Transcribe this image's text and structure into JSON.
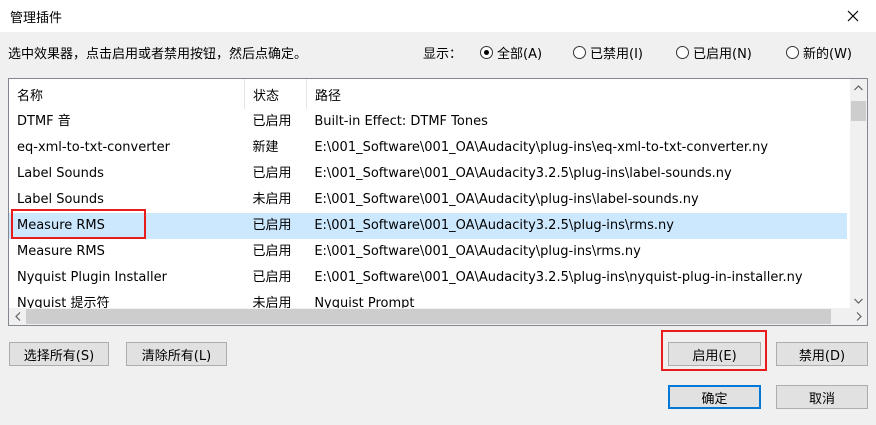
{
  "window": {
    "title": "管理插件"
  },
  "instruction": "选中效果器，点击启用或者禁用按钮，然后点确定。",
  "filter": {
    "label": "显示：",
    "options": [
      {
        "label": "全部(A)",
        "selected": true
      },
      {
        "label": "已禁用(I)",
        "selected": false
      },
      {
        "label": "已启用(N)",
        "selected": false
      },
      {
        "label": "新的(W)",
        "selected": false
      }
    ]
  },
  "list": {
    "headers": [
      "名称",
      "状态",
      "路径"
    ],
    "rows": [
      {
        "name": "DTMF 音",
        "status": "已启用",
        "path": "Built-in Effect: DTMF Tones"
      },
      {
        "name": "eq-xml-to-txt-converter",
        "status": "新建",
        "path": "E:\\001_Software\\001_OA\\Audacity\\plug-ins\\eq-xml-to-txt-converter.ny"
      },
      {
        "name": "Label Sounds",
        "status": "已启用",
        "path": "E:\\001_Software\\001_OA\\Audacity3.2.5\\plug-ins\\label-sounds.ny"
      },
      {
        "name": "Label Sounds",
        "status": "未启用",
        "path": "E:\\001_Software\\001_OA\\Audacity\\plug-ins\\label-sounds.ny"
      },
      {
        "name": "Measure RMS",
        "status": "已启用",
        "path": "E:\\001_Software\\001_OA\\Audacity3.2.5\\plug-ins\\rms.ny",
        "selected": true
      },
      {
        "name": "Measure RMS",
        "status": "已启用",
        "path": "E:\\001_Software\\001_OA\\Audacity\\plug-ins\\rms.ny"
      },
      {
        "name": "Nyquist Plugin Installer",
        "status": "已启用",
        "path": "E:\\001_Software\\001_OA\\Audacity3.2.5\\plug-ins\\nyquist-plug-in-installer.ny"
      },
      {
        "name": "Nyquist 提示符",
        "status": "未启用",
        "path": "Nyquist Prompt"
      }
    ]
  },
  "buttons": {
    "select_all": "选择所有(S)",
    "clear_all": "清除所有(L)",
    "enable": "启用(E)",
    "disable": "禁用(D)",
    "ok": "确定",
    "cancel": "取消"
  },
  "colors": {
    "selection": "#cce8ff",
    "highlight_box": "#e81c1c",
    "focus": "#0078d7"
  }
}
